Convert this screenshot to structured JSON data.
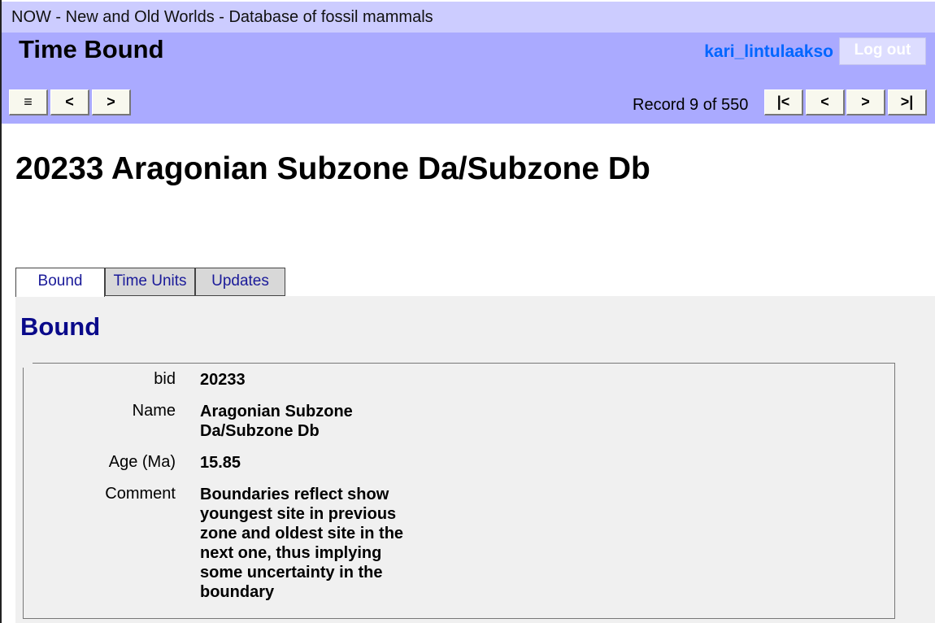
{
  "app": {
    "title": "NOW - New and Old Worlds - Database of fossil mammals"
  },
  "header": {
    "page_title": "Time Bound",
    "username": "kari_lintulaakso",
    "logout_label": "Log out",
    "menu_label": "≡",
    "back_label": "<",
    "forward_label": ">"
  },
  "pager": {
    "record_text": "Record 9 of 550",
    "first_label": "|<",
    "prev_label": "<",
    "next_label": ">",
    "last_label": ">|"
  },
  "record": {
    "title": "20233 Aragonian Subzone Da/Subzone Db"
  },
  "tabs": [
    {
      "label": "Bound",
      "active": true
    },
    {
      "label": "Time Units",
      "active": false
    },
    {
      "label": "Updates",
      "active": false
    }
  ],
  "section": {
    "heading": "Bound"
  },
  "fields": [
    {
      "label": "bid",
      "value": "20233"
    },
    {
      "label": "Name",
      "value": "Aragonian Subzone Da/Subzone Db"
    },
    {
      "label": "Age (Ma)",
      "value": "15.85"
    },
    {
      "label": "Comment",
      "value": "Boundaries reflect show youngest site in previous zone and oldest site in the next one, thus implying some uncertainty in the boundary"
    }
  ],
  "colors": {
    "title_bar": "#ccccff",
    "header": "#aaaaff",
    "username": "#0066ff",
    "section_heading": "#0a0a8a",
    "tab_text": "#1a1a99",
    "content_bg": "#f0f0f0"
  }
}
